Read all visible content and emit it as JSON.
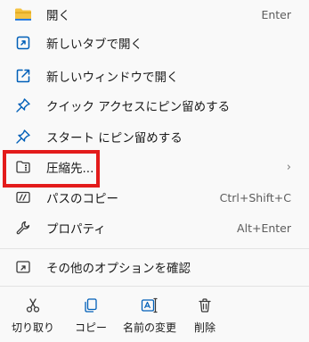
{
  "menu": {
    "items": [
      {
        "label": "開く",
        "shortcut": "Enter",
        "icon": "folder-icon"
      },
      {
        "label": "新しいタブで開く",
        "icon": "open-in-new-tab-icon"
      },
      {
        "label": "新しいウィンドウで開く",
        "icon": "open-in-new-window-icon"
      },
      {
        "label": "クイック アクセスにピン留めする",
        "icon": "pin-icon"
      },
      {
        "label": "スタート にピン留めする",
        "icon": "pin-icon"
      },
      {
        "label": "圧縮先...",
        "chevron": "›",
        "icon": "archive-icon"
      },
      {
        "label": "パスのコピー",
        "shortcut": "Ctrl+Shift+C",
        "icon": "copy-path-icon"
      },
      {
        "label": "プロパティ",
        "shortcut": "Alt+Enter",
        "icon": "wrench-icon"
      },
      {
        "label": "その他のオプションを確認",
        "icon": "more-options-icon"
      }
    ],
    "quick_actions": [
      {
        "label": "切り取り",
        "icon": "cut-icon"
      },
      {
        "label": "コピー",
        "icon": "copy-icon"
      },
      {
        "label": "名前の変更",
        "icon": "rename-icon"
      },
      {
        "label": "削除",
        "icon": "delete-icon"
      }
    ]
  },
  "colors": {
    "accent": "#005fb8",
    "folder": "#f5c342",
    "highlight_border": "#e31b1b",
    "background": "#f9f9f9"
  }
}
